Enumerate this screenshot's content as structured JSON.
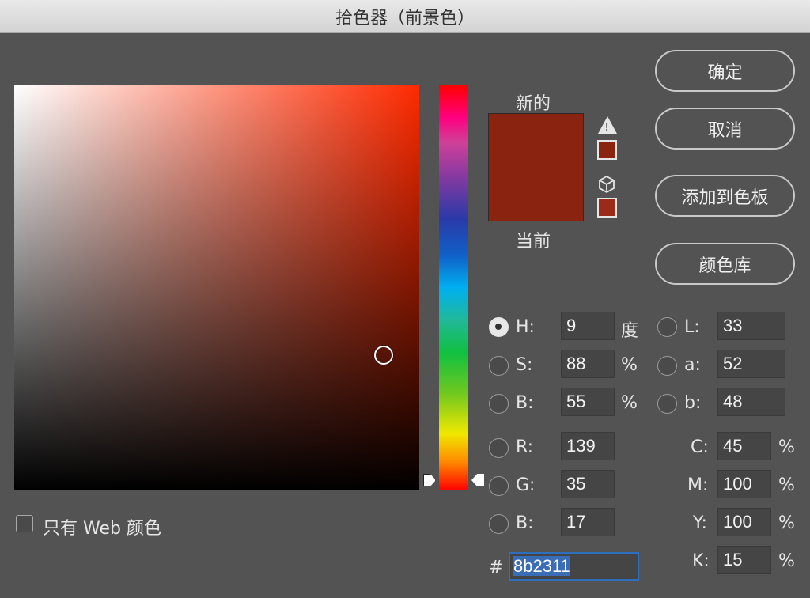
{
  "window": {
    "title": "拾色器（前景色）"
  },
  "picker": {
    "hue_slider_position": 1.0,
    "selected_color": "#8b2311",
    "current_color": "#8b2311"
  },
  "swatch": {
    "new_label": "新的",
    "current_label": "当前",
    "warning_swatch_color": "#8b2311",
    "web_swatch_color": "#9c2a1b"
  },
  "buttons": {
    "ok": "确定",
    "cancel": "取消",
    "add_to_swatches": "添加到色板",
    "color_libraries": "颜色库"
  },
  "hsb": {
    "h": {
      "label": "H:",
      "value": "9",
      "unit": "度",
      "selected": true
    },
    "s": {
      "label": "S:",
      "value": "88",
      "unit": "%"
    },
    "b": {
      "label": "B:",
      "value": "55",
      "unit": "%"
    }
  },
  "lab": {
    "l": {
      "label": "L:",
      "value": "33"
    },
    "a": {
      "label": "a:",
      "value": "52"
    },
    "b": {
      "label": "b:",
      "value": "48"
    }
  },
  "rgb": {
    "r": {
      "label": "R:",
      "value": "139"
    },
    "g": {
      "label": "G:",
      "value": "35"
    },
    "b": {
      "label": "B:",
      "value": "17"
    }
  },
  "cmyk": {
    "c": {
      "label": "C:",
      "value": "45",
      "unit": "%"
    },
    "m": {
      "label": "M:",
      "value": "100",
      "unit": "%"
    },
    "y": {
      "label": "Y:",
      "value": "100",
      "unit": "%"
    },
    "k": {
      "label": "K:",
      "value": "15",
      "unit": "%"
    }
  },
  "hex": {
    "label": "#",
    "value": "8b2311"
  },
  "web_only": {
    "label": "只有 Web 颜色",
    "checked": false
  }
}
